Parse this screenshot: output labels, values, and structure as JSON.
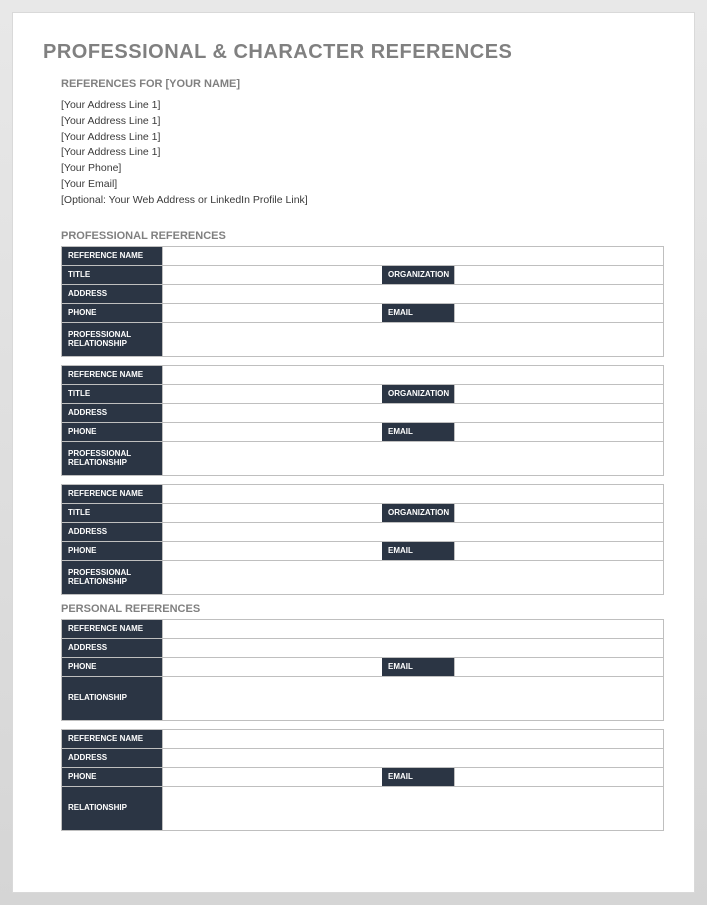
{
  "title": "PROFESSIONAL & CHARACTER REFERENCES",
  "subheading": "REFERENCES FOR [YOUR NAME]",
  "info_lines": [
    "[Your Address Line 1]",
    "[Your Address Line 1]",
    "[Your Address Line 1]",
    "[Your Address Line 1]",
    "[Your Phone]",
    "[Your Email]",
    "[Optional: Your Web Address or LinkedIn Profile Link]"
  ],
  "sections": {
    "professional": {
      "title": "PROFESSIONAL REFERENCES",
      "labels": {
        "reference_name": "REFERENCE NAME",
        "title": "TITLE",
        "organization": "ORGANIZATION",
        "address": "ADDRESS",
        "phone": "PHONE",
        "email": "EMAIL",
        "relationship": "PROFESSIONAL RELATIONSHIP"
      },
      "entries": [
        {
          "reference_name": "",
          "title": "",
          "organization": "",
          "address": "",
          "phone": "",
          "email": "",
          "relationship": ""
        },
        {
          "reference_name": "",
          "title": "",
          "organization": "",
          "address": "",
          "phone": "",
          "email": "",
          "relationship": ""
        },
        {
          "reference_name": "",
          "title": "",
          "organization": "",
          "address": "",
          "phone": "",
          "email": "",
          "relationship": ""
        }
      ]
    },
    "personal": {
      "title": "PERSONAL REFERENCES",
      "labels": {
        "reference_name": "REFERENCE NAME",
        "address": "ADDRESS",
        "phone": "PHONE",
        "email": "EMAIL",
        "relationship": "RELATIONSHIP"
      },
      "entries": [
        {
          "reference_name": "",
          "address": "",
          "phone": "",
          "email": "",
          "relationship": ""
        },
        {
          "reference_name": "",
          "address": "",
          "phone": "",
          "email": "",
          "relationship": ""
        }
      ]
    }
  }
}
